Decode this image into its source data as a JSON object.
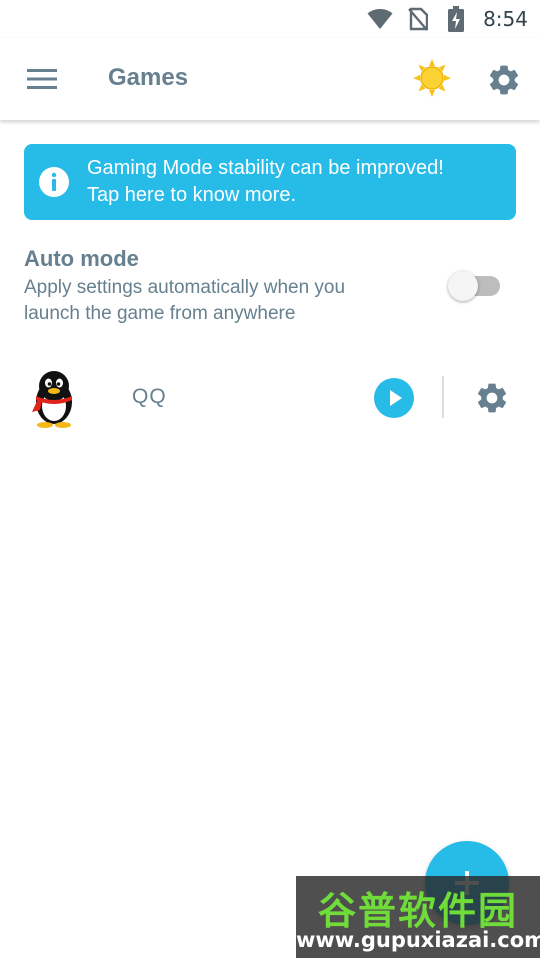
{
  "status_bar": {
    "time": "8:54",
    "icons": [
      "wifi-icon",
      "no-sim-icon",
      "battery-charging-icon"
    ]
  },
  "app_bar": {
    "title": "Games",
    "menu_icon": "menu-icon",
    "mode_icon": "sun-icon",
    "settings_icon": "settings-icon"
  },
  "banner": {
    "line1": "Gaming Mode stability can be improved!",
    "line2": "Tap here to know more.",
    "icon": "info-icon"
  },
  "auto_mode": {
    "title": "Auto mode",
    "description_line1": "Apply settings automatically when you",
    "description_line2": "launch the game from anywhere",
    "enabled": false
  },
  "games": [
    {
      "name": "QQ",
      "icon": "qq-penguin-icon",
      "actions": [
        "play-icon",
        "settings-icon"
      ]
    }
  ],
  "fab": {
    "icon": "plus-icon"
  },
  "watermark": {
    "text_cn": "谷普软件园",
    "url": "www.gupuxiazai.com"
  },
  "colors": {
    "accent": "#27bbe8",
    "text": "#66808f",
    "sun": "#f7c21a",
    "toggle_track": "#bdbdbd",
    "watermark_green": "#6fdc3a"
  }
}
